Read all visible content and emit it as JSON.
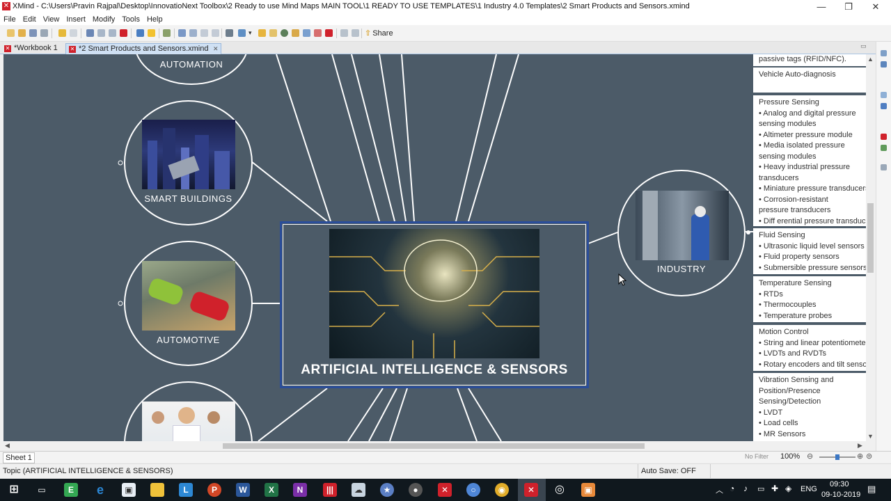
{
  "window": {
    "title": "XMind - C:\\Users\\Pravin Rajpal\\Desktop\\InnovatioNext Toolbox\\2 Ready to use Mind Maps MAIN TOOL\\1 READY TO USE TEMPLATES\\1 Industry 4.0 Templates\\2 Smart Products and Sensors.xmind",
    "minimize": "—",
    "maximize": "❐",
    "close": "✕"
  },
  "menu": [
    "File",
    "Edit",
    "View",
    "Insert",
    "Modify",
    "Tools",
    "Help"
  ],
  "toolbar": {
    "share_label": "Share"
  },
  "tabs": [
    {
      "label": "*Workbook 1",
      "active": false
    },
    {
      "label": "*2 Smart Products and Sensors.xmind",
      "active": true
    }
  ],
  "map": {
    "central_topic": "ARTIFICIAL INTELLIGENCE & SENSORS",
    "topics": {
      "automation": "AUTOMATION",
      "smart_buildings": "SMART BUILDINGS",
      "automotive": "AUTOMOTIVE",
      "industry": "INDUSTRY"
    },
    "notes": {
      "top": {
        "lines": [
          "passive tags (RFID/NFC)."
        ]
      },
      "vehicle": {
        "lines": [
          "Vehicle Auto-diagnosis"
        ]
      },
      "pressure": {
        "lines": [
          "Pressure Sensing",
          "• Analog and digital pressure",
          "sensing modules",
          "• Altimeter pressure module",
          "• Media isolated pressure",
          "sensing modules",
          "• Heavy industrial pressure",
          "transducers",
          "• Miniature pressure transducers",
          "• Corrosion-resistant",
          "pressure transducers",
          "• Diff erential pressure transducers"
        ]
      },
      "fluid": {
        "lines": [
          "Fluid Sensing",
          "• Ultrasonic liquid level sensors",
          "• Fluid property sensors",
          "• Submersible pressure sensors"
        ]
      },
      "temperature": {
        "lines": [
          "Temperature Sensing",
          "• RTDs",
          "• Thermocouples",
          "• Temperature probes"
        ]
      },
      "motion": {
        "lines": [
          "Motion Control",
          "• String and linear potentiometers",
          "• LVDTs and RVDTs",
          "• Rotary encoders and tilt sensors"
        ]
      },
      "vibration": {
        "lines": [
          "Vibration Sensing and",
          "Position/Presence",
          "Sensing/Detection",
          "• LVDT",
          "• Load cells",
          "• MR Sensors"
        ]
      }
    }
  },
  "sheetbar": {
    "sheet_tab": "Sheet 1",
    "filter": "No Filter",
    "zoom": "100%",
    "zoom_level": 0.5
  },
  "status": {
    "selection": "Topic (ARTIFICIAL INTELLIGENCE & SENSORS)",
    "autosave": "Auto Save: OFF"
  },
  "taskbar": {
    "lang": "ENG",
    "time": "09:30",
    "date": "09-10-2019"
  },
  "colors": {
    "canvas": "#4c5b68",
    "central_border": "#2a4d9a",
    "accent": "#d0212b"
  }
}
